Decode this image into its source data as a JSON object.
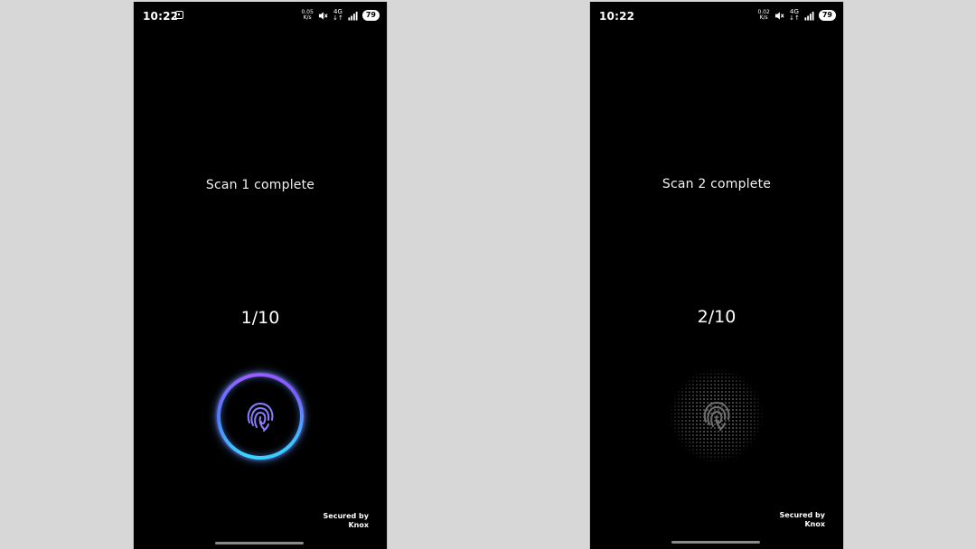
{
  "screens": [
    {
      "status": {
        "time": "10:22",
        "net_speed_value": "0.05",
        "net_speed_unit": "K/s",
        "net_type": "4G",
        "net_arrows": "↓↑",
        "battery": "79"
      },
      "headline": "Scan 1 complete",
      "progress_label": "1/10",
      "progress_fraction": 0.1,
      "sensor_state": "active-ring",
      "footer_line1": "Secured by",
      "footer_line2": "Knox"
    },
    {
      "status": {
        "time": "10:22",
        "net_speed_value": "0.02",
        "net_speed_unit": "K/s",
        "net_type": "4G",
        "net_arrows": "↓↑",
        "battery": "79"
      },
      "headline": "Scan 2 complete",
      "progress_label": "2/10",
      "progress_fraction": 0.2,
      "sensor_state": "dotted-idle",
      "footer_line1": "Secured by",
      "footer_line2": "Knox"
    }
  ],
  "colors": {
    "background": "#d7d7d7",
    "screen": "#000000",
    "ring_cyan": "#3ad6ff",
    "ring_blue": "#4f7bff",
    "ring_purple": "#a05cff",
    "fingerprint_active": "#8a7dff",
    "fingerprint_idle": "#6f6f6f"
  },
  "icons": [
    "screenshot-icon",
    "mute-icon",
    "signal-icon",
    "fingerprint-icon"
  ]
}
